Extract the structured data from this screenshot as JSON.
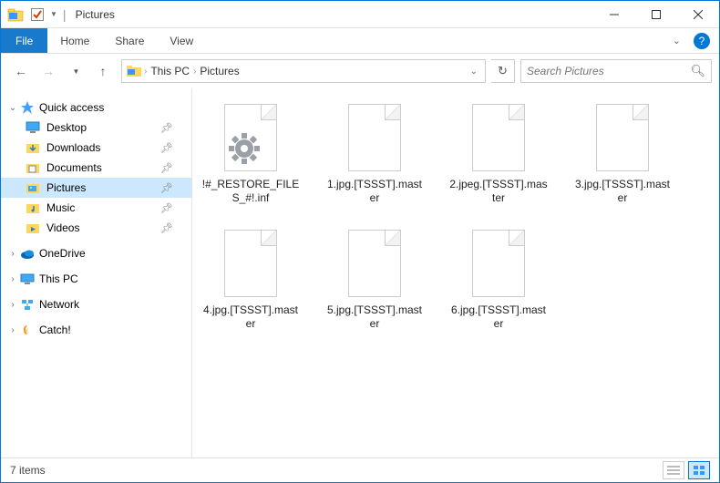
{
  "window": {
    "title": "Pictures"
  },
  "ribbon": {
    "file": "File",
    "tabs": [
      "Home",
      "Share",
      "View"
    ]
  },
  "breadcrumb": [
    "This PC",
    "Pictures"
  ],
  "search": {
    "placeholder": "Search Pictures"
  },
  "nav": {
    "quick_access": {
      "label": "Quick access",
      "items": [
        {
          "label": "Desktop",
          "icon": "desktop"
        },
        {
          "label": "Downloads",
          "icon": "downloads"
        },
        {
          "label": "Documents",
          "icon": "documents"
        },
        {
          "label": "Pictures",
          "icon": "pictures",
          "selected": true
        },
        {
          "label": "Music",
          "icon": "music"
        },
        {
          "label": "Videos",
          "icon": "videos"
        }
      ]
    },
    "other": [
      {
        "label": "OneDrive",
        "icon": "onedrive"
      },
      {
        "label": "This PC",
        "icon": "thispc"
      },
      {
        "label": "Network",
        "icon": "network"
      },
      {
        "label": "Catch!",
        "icon": "catch"
      }
    ]
  },
  "files": [
    {
      "name": "!#_RESTORE_FILES_#!.inf",
      "type": "inf"
    },
    {
      "name": "1.jpg.[TSSST].master",
      "type": "blank"
    },
    {
      "name": "2.jpeg.[TSSST].master",
      "type": "blank"
    },
    {
      "name": "3.jpg.[TSSST].master",
      "type": "blank"
    },
    {
      "name": "4.jpg.[TSSST].master",
      "type": "blank"
    },
    {
      "name": "5.jpg.[TSSST].master",
      "type": "blank"
    },
    {
      "name": "6.jpg.[TSSST].master",
      "type": "blank"
    }
  ],
  "status": {
    "count_text": "7 items"
  }
}
